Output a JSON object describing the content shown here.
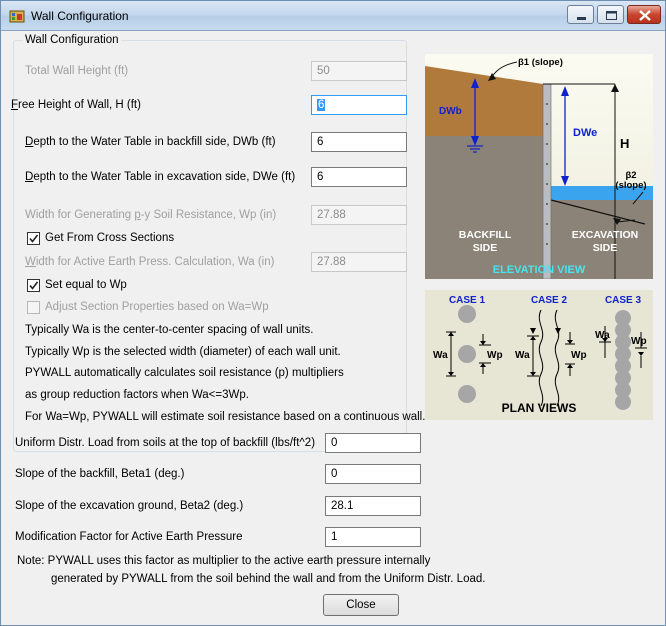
{
  "window": {
    "title": "Wall Configuration"
  },
  "group": {
    "title": "Wall Configuration"
  },
  "fields": {
    "total_height": {
      "label": "Total Wall Height (ft)",
      "value": "50"
    },
    "free_height": {
      "label_pre": "",
      "label_key": "F",
      "label_post": "ree Height of Wall, H (ft)",
      "value": "6"
    },
    "dwb": {
      "label_key": "D",
      "label_post": "epth to the Water Table in backfill side, DWb (ft)",
      "value": "6"
    },
    "dwe": {
      "label_key": "D",
      "label_post": "epth to the Water Table in excavation side, DWe (ft)",
      "value": "6"
    },
    "wp": {
      "label_pre": "Width for Generating ",
      "label_key": "p",
      "label_post": "-y Soil Resistance, Wp (in)",
      "value": "27.88"
    },
    "wa": {
      "label_key": "W",
      "label_post": "idth for Active Earth Press. Calculation, Wa (in)",
      "value": "27.88"
    },
    "load": {
      "label": "Uniform Distr. Load from soils at the top of backfill  (lbs/ft^2)",
      "value": "0"
    },
    "beta1": {
      "label": "Slope of the backfill, Beta1 (deg.)",
      "value": "0"
    },
    "beta2": {
      "label": "Slope of the excavation ground, Beta2 (deg.)",
      "value": "28.1"
    },
    "mod": {
      "label": "Modification Factor for Active Earth Pressure",
      "value": "1"
    }
  },
  "checks": {
    "get_from_cross": "Get From Cross Sections",
    "set_equal": "Set equal to Wp",
    "adjust": "Adjust Section Properties based on Wa=Wp"
  },
  "info": [
    "Typically Wa is the center-to-center spacing of wall units.",
    "Typically Wp is the selected width (diameter) of each wall unit.",
    "PYWALL automatically calculates soil resistance (p) multipliers",
    "as group reduction factors when Wa<=3Wp.",
    "For Wa=Wp, PYWALL will estimate soil resistance based on a continuous wall."
  ],
  "note": {
    "line1": "Note:  PYWALL uses this factor as multiplier to the active earth pressure internally",
    "line2": "generated by PYWALL from the soil behind the wall and from the Uniform Distr. Load."
  },
  "close_label": "Close",
  "elevation": {
    "beta1": "β1 (slope)",
    "dwb": "DWb",
    "dwe": "DWe",
    "h": "H",
    "beta2_a": "β2",
    "beta2_b": "(slope)",
    "backfill_a": "BACKFILL",
    "backfill_b": "SIDE",
    "excavation_a": "EXCAVATION",
    "excavation_b": "SIDE",
    "caption": "ELEVATION VIEW"
  },
  "plan": {
    "case1": "CASE 1",
    "case2": "CASE 2",
    "case3": "CASE 3",
    "wa": "Wa",
    "wp": "Wp",
    "caption": "PLAN VIEWS"
  },
  "colors": {
    "soil_top": "#b07a3c",
    "soil_gray": "#8c8378",
    "water": "#3aa5ee",
    "arrow_blue": "#1022cc",
    "caption_cyan": "#48e4f0"
  }
}
